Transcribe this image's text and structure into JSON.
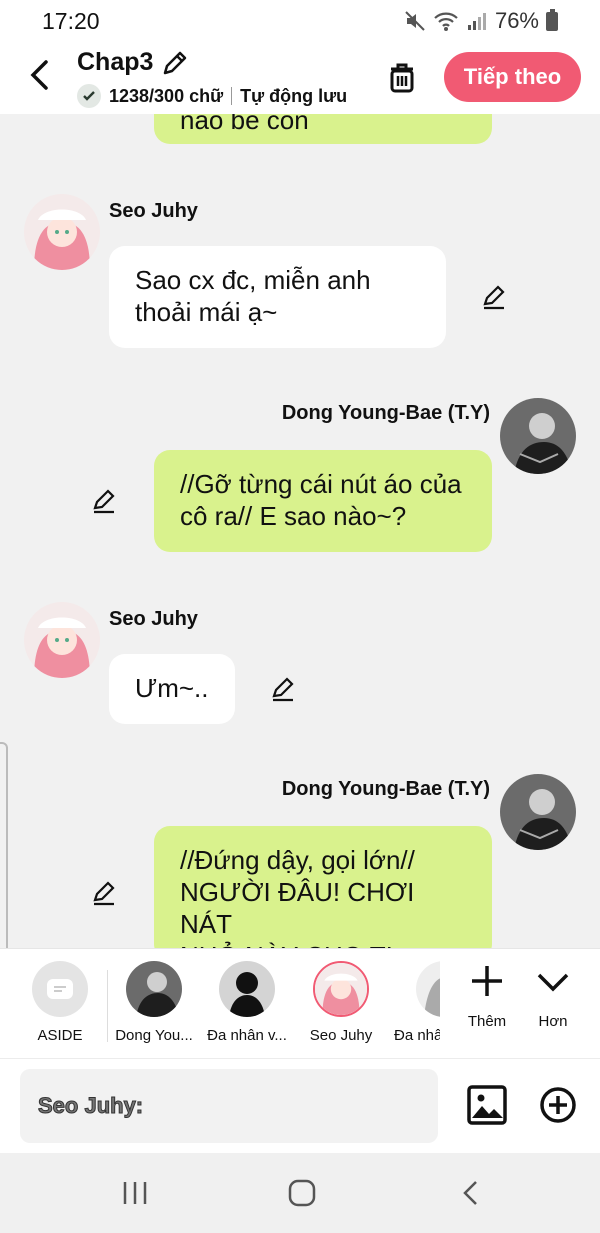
{
  "status_bar": {
    "time": "17:20",
    "battery": "76%"
  },
  "header": {
    "title": "Chap3",
    "word_count": "1238/300 chữ",
    "autosave": "Tự động lưu",
    "next_button": "Tiếp theo"
  },
  "messages": [
    {
      "side": "right",
      "text": "nào bé con"
    },
    {
      "side": "left",
      "sender": "Seo Juhy",
      "text_lines": [
        "Sao cx đc, miễn anh",
        "thoải mái ạ~"
      ]
    },
    {
      "side": "right",
      "sender": "Dong Young-Bae (T.Y)",
      "text_lines": [
        "//Gỡ từng cái nút áo của",
        "cô ra// E sao nào~?"
      ]
    },
    {
      "side": "left",
      "sender": "Seo Juhy",
      "text_lines": [
        "Ưm~.."
      ]
    },
    {
      "side": "right",
      "sender": "Dong Young-Bae (T.Y)",
      "text_lines": [
        "//Đứng dậy, gọi lớn//",
        "NGƯỜI ĐÂU! CHƠI NÁT",
        "NHỎ NÀY CHO T!"
      ]
    }
  ],
  "characters": [
    {
      "label": "ASIDE"
    },
    {
      "label": "Dong You..."
    },
    {
      "label": "Đa nhân v..."
    },
    {
      "label": "Seo Juhy"
    },
    {
      "label": "Đa nhâ"
    }
  ],
  "actions": {
    "add": "Thêm",
    "more": "Hơn"
  },
  "input": {
    "placeholder": "Seo Juhy:"
  },
  "colors": {
    "accent": "#f15a73",
    "right_bubble": "#d9f28d",
    "left_bubble": "#ffffff",
    "background": "#f1f1f1"
  }
}
